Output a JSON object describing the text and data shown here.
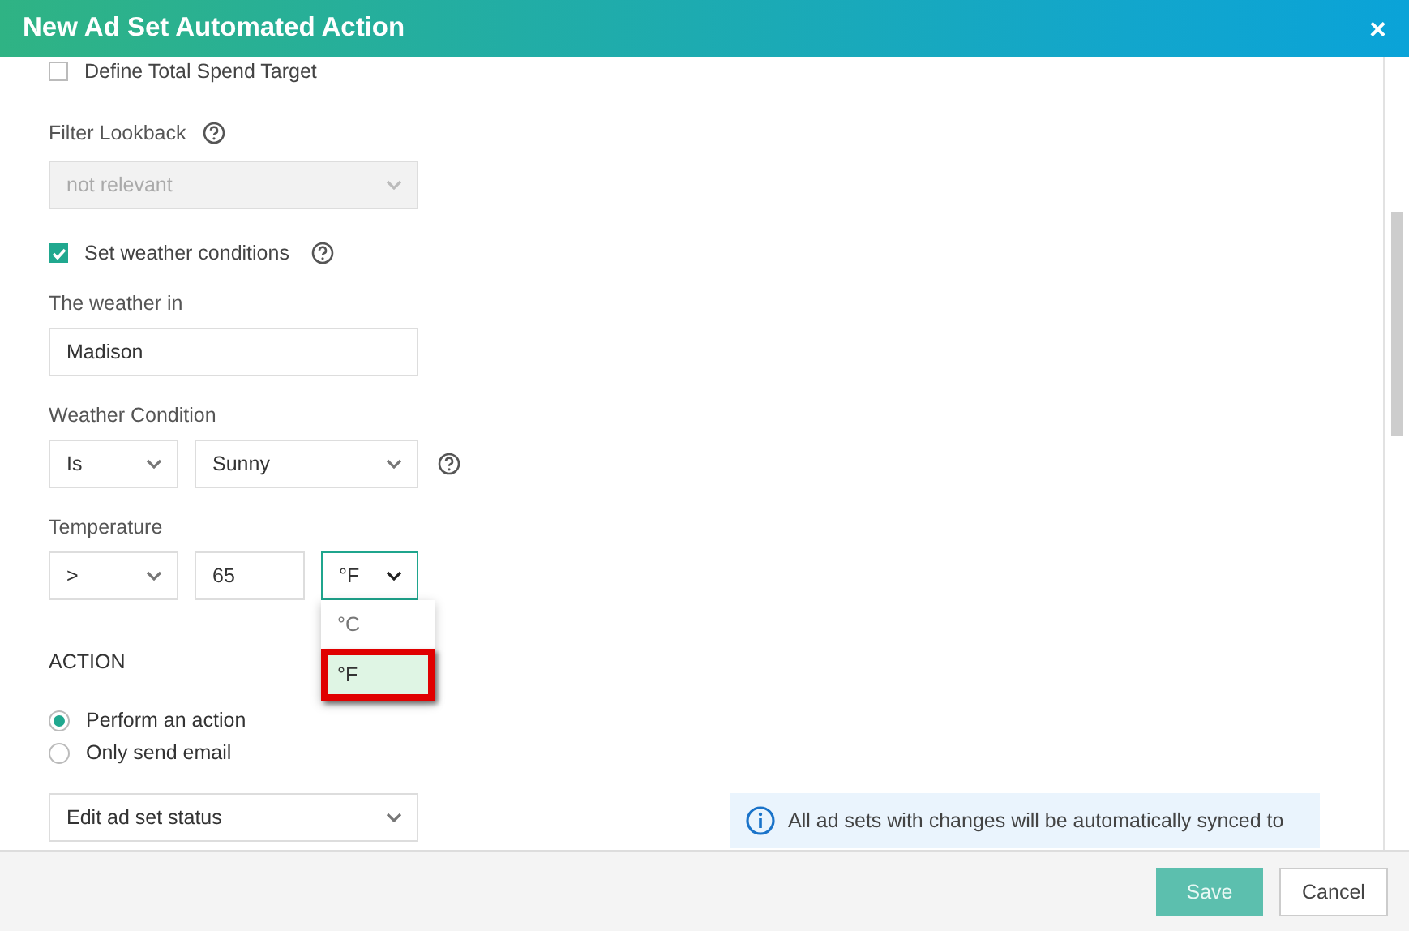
{
  "window": {
    "title": "New Ad Set Automated Action",
    "close": "×"
  },
  "spend_target": {
    "label": "Define Total Spend Target",
    "checked": false
  },
  "filter_lookback": {
    "label": "Filter Lookback",
    "value": "not relevant",
    "disabled": true
  },
  "weather": {
    "label": "Set weather conditions",
    "checked": true
  },
  "weather_in": {
    "label": "The weather in",
    "value": "Madison"
  },
  "weather_condition": {
    "label": "Weather Condition",
    "operator": "Is",
    "condition": "Sunny"
  },
  "temperature": {
    "label": "Temperature",
    "operator": ">",
    "value": "65",
    "unit": "°F",
    "options": [
      {
        "label": "°C",
        "selected": false
      },
      {
        "label": "°F",
        "selected": true
      }
    ]
  },
  "action": {
    "heading": "ACTION",
    "options": [
      {
        "label": "Perform an action",
        "selected": true
      },
      {
        "label": "Only send email",
        "selected": false
      }
    ],
    "select": "Edit ad set status"
  },
  "info": "All ad sets with changes will be automatically synced to",
  "buttons": {
    "save": "Save",
    "cancel": "Cancel"
  }
}
